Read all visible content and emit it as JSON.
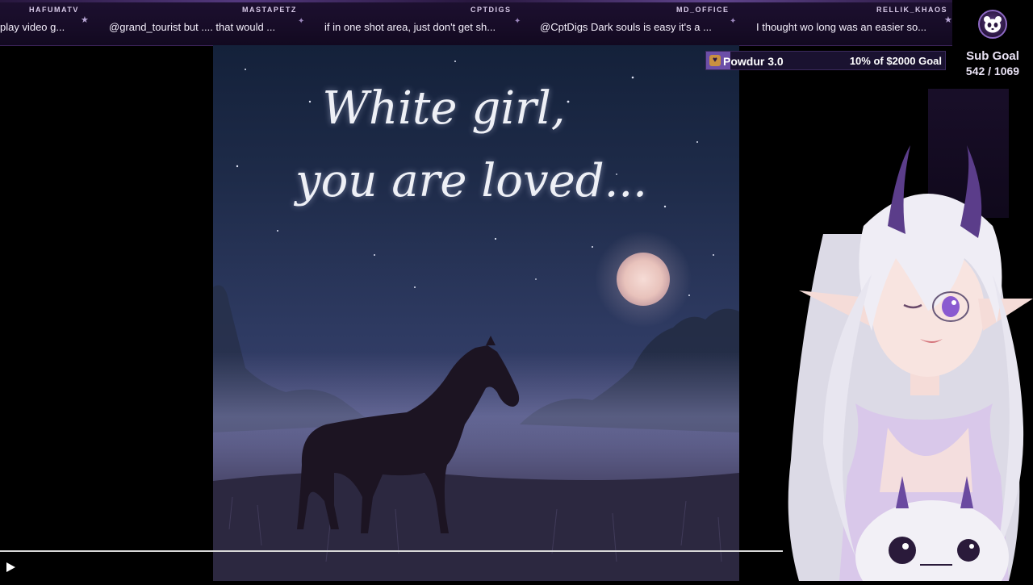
{
  "ticker": {
    "messages": [
      {
        "user": "HAFUMATV",
        "text": "play video g..."
      },
      {
        "user": "MASTAPETZ",
        "text": "@grand_tourist but .... that would ..."
      },
      {
        "user": "CPTDIGS",
        "text": "if in one shot area, just don't get sh..."
      },
      {
        "user": "MD_OFFICE",
        "text": "@CptDigs Dark souls is easy it's a ..."
      },
      {
        "user": "RELLIK_KHAOS",
        "text": "I thought wo long was an easier so..."
      }
    ]
  },
  "sub_goal": {
    "title": "Sub Goal",
    "count": "542 / 1069",
    "icon": "panda-icon"
  },
  "donation_goal": {
    "name": "Powdur 3.0",
    "amount_text": "10% of $2000 Goal",
    "progress_fraction": 0.1,
    "icon": "gift-icon"
  },
  "video": {
    "caption_line1": "White girl,",
    "caption_line2": "you are loved...",
    "progress_fraction": 0.0
  },
  "colors": {
    "ticker_bg": "#170c27",
    "accent": "#6c4fa8",
    "avatar_hair": "#eceaf2",
    "horn": "#5b3d8a"
  }
}
